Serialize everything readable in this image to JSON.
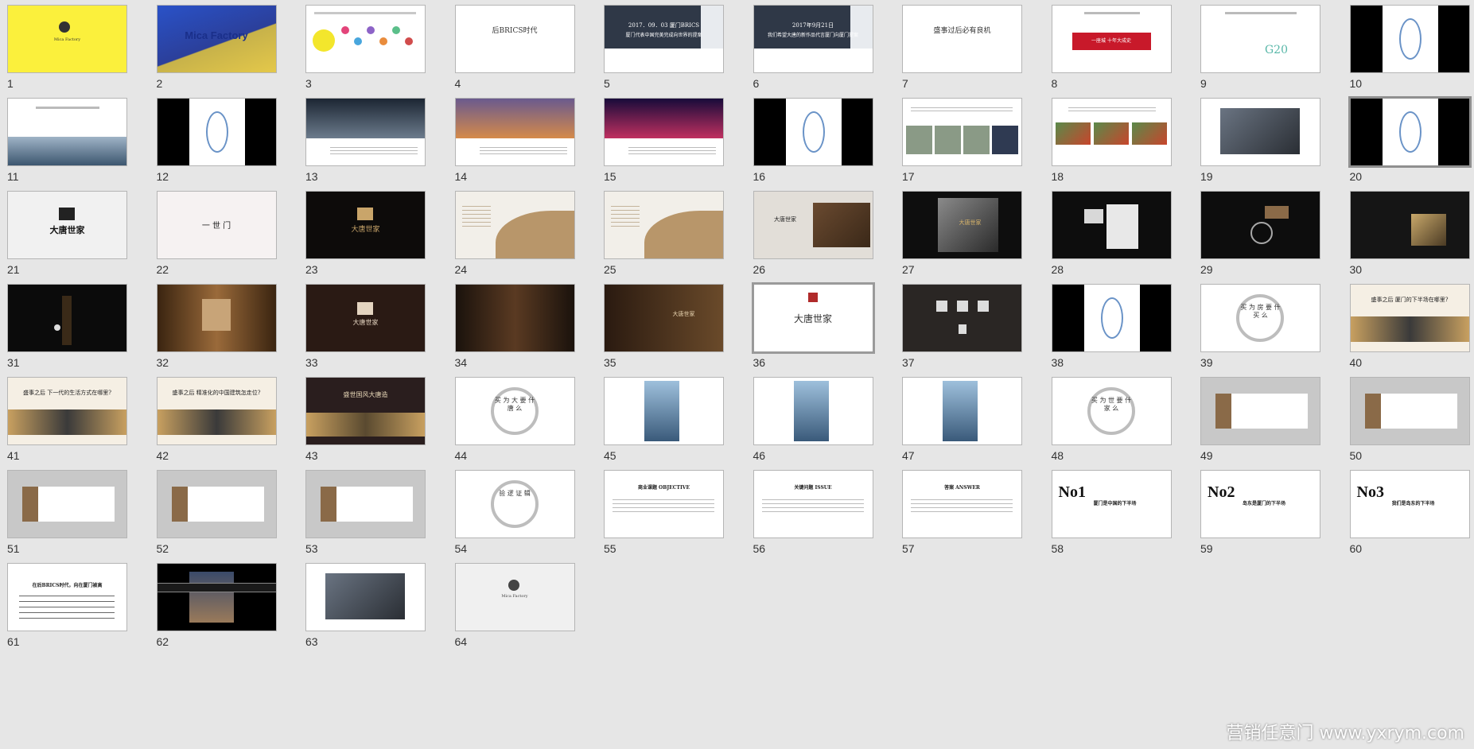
{
  "window": {
    "background": "#e6e6e6"
  },
  "watermark": {
    "text": "营销任意门 www.yxrym.com"
  },
  "slides": [
    {
      "n": "1",
      "style": "yellow",
      "caption": "Mica Factory"
    },
    {
      "n": "2",
      "style": "photo-blue",
      "caption": "Mica Factory"
    },
    {
      "n": "3",
      "style": "mindmap",
      "caption": ""
    },
    {
      "n": "4",
      "style": "white-title",
      "caption": "后BRICS时代"
    },
    {
      "n": "5",
      "style": "white-twoline",
      "caption": "2017．09．03 厦门BRICS",
      "caption2": "厦门代表中国完美完成向世界的提案"
    },
    {
      "n": "6",
      "style": "white-twoline",
      "caption": "2017年9月21日",
      "caption2": "我们希望大唐的新作品代言厦门向厦门提案"
    },
    {
      "n": "7",
      "style": "white-title",
      "caption": "盛事过后必有良机"
    },
    {
      "n": "8",
      "style": "white-red",
      "caption": "一座城 十年大成史"
    },
    {
      "n": "9",
      "style": "white-g20",
      "caption": "G20"
    },
    {
      "n": "10",
      "style": "black-ring",
      "caption": ""
    },
    {
      "n": "11",
      "style": "white-city",
      "caption": ""
    },
    {
      "n": "12",
      "style": "black-ring",
      "caption": ""
    },
    {
      "n": "13",
      "style": "photo-night",
      "caption": ""
    },
    {
      "n": "14",
      "style": "photo-street",
      "caption": ""
    },
    {
      "n": "15",
      "style": "photo-neon",
      "caption": ""
    },
    {
      "n": "16",
      "style": "black-ring",
      "caption": ""
    },
    {
      "n": "17",
      "style": "white-photos",
      "caption": ""
    },
    {
      "n": "18",
      "style": "white-maps",
      "caption": ""
    },
    {
      "n": "19",
      "style": "white-hands",
      "caption": ""
    },
    {
      "n": "20",
      "style": "black-ring",
      "caption": "",
      "selected": true
    },
    {
      "n": "21",
      "style": "logo-light",
      "caption": "大唐世家"
    },
    {
      "n": "22",
      "style": "logo-parts",
      "caption": "一 世 门"
    },
    {
      "n": "23",
      "style": "logo-dark",
      "caption": "大唐世家"
    },
    {
      "n": "24",
      "style": "wave-gold",
      "caption": ""
    },
    {
      "n": "25",
      "style": "wave-gold2",
      "caption": ""
    },
    {
      "n": "26",
      "style": "logo-wood",
      "caption": "大唐世家"
    },
    {
      "n": "27",
      "style": "dark-sign",
      "caption": "大唐世家"
    },
    {
      "n": "28",
      "style": "dark-bag",
      "caption": ""
    },
    {
      "n": "29",
      "style": "dark-key",
      "caption": ""
    },
    {
      "n": "30",
      "style": "dark-box",
      "caption": ""
    },
    {
      "n": "31",
      "style": "dark-stand",
      "caption": ""
    },
    {
      "n": "32",
      "style": "wood-hall",
      "caption": ""
    },
    {
      "n": "33",
      "style": "logo-brown",
      "caption": "大唐世家"
    },
    {
      "n": "34",
      "style": "dark-interior",
      "caption": ""
    },
    {
      "n": "35",
      "style": "dark-lobby",
      "caption": "大唐世家"
    },
    {
      "n": "36",
      "style": "logo-seal",
      "caption": "大唐世家"
    },
    {
      "n": "37",
      "style": "dark-icons",
      "caption": ""
    },
    {
      "n": "38",
      "style": "black-ring",
      "caption": ""
    },
    {
      "n": "39",
      "style": "ring-text",
      "caption": "买 为 房 要 什 买 么"
    },
    {
      "n": "40",
      "style": "banner-mountain",
      "caption": "盛事之后 厦门的下半场在哪里?"
    },
    {
      "n": "41",
      "style": "banner-mountain",
      "caption": "盛事之后 下一代的生活方式在哪里?"
    },
    {
      "n": "42",
      "style": "banner-mountain",
      "caption": "盛事之后 精准化的中国建筑怎走位?"
    },
    {
      "n": "43",
      "style": "banner-dark",
      "caption": "盛世国风大唐造"
    },
    {
      "n": "44",
      "style": "ring-text",
      "caption": "买 为 大 要 什 唐 么"
    },
    {
      "n": "45",
      "style": "poster-blue",
      "caption": ""
    },
    {
      "n": "46",
      "style": "poster-blue",
      "caption": ""
    },
    {
      "n": "47",
      "style": "poster-blue",
      "caption": ""
    },
    {
      "n": "48",
      "style": "ring-text",
      "caption": "买 为 世 要 什 家 么"
    },
    {
      "n": "49",
      "style": "grey-sketch",
      "caption": ""
    },
    {
      "n": "50",
      "style": "grey-sketch",
      "caption": ""
    },
    {
      "n": "51",
      "style": "grey-sketch",
      "caption": ""
    },
    {
      "n": "52",
      "style": "grey-sketch",
      "caption": ""
    },
    {
      "n": "53",
      "style": "grey-sketch",
      "caption": ""
    },
    {
      "n": "54",
      "style": "ring-text",
      "caption": "验 逻 证 辑"
    },
    {
      "n": "55",
      "style": "white-heading",
      "caption": "商业课题 OBJECTIVE"
    },
    {
      "n": "56",
      "style": "white-heading",
      "caption": "关键问题 ISSUE"
    },
    {
      "n": "57",
      "style": "white-heading",
      "caption": "答案 ANSWER"
    },
    {
      "n": "58",
      "style": "white-no",
      "caption": "No1",
      "caption2": "厦门是中国的下半场"
    },
    {
      "n": "59",
      "style": "white-no",
      "caption": "No2",
      "caption2": "岛东是厦门的下半场"
    },
    {
      "n": "60",
      "style": "white-no",
      "caption": "No3",
      "caption2": "我们是岛东的下半场"
    },
    {
      "n": "61",
      "style": "white-poem",
      "caption": "在后BRICS时代，向在厦门被高"
    },
    {
      "n": "62",
      "style": "photo-collage",
      "caption": ""
    },
    {
      "n": "63",
      "style": "white-hands",
      "caption": ""
    },
    {
      "n": "64",
      "style": "grey-logo",
      "caption": "Mica Factory"
    }
  ]
}
